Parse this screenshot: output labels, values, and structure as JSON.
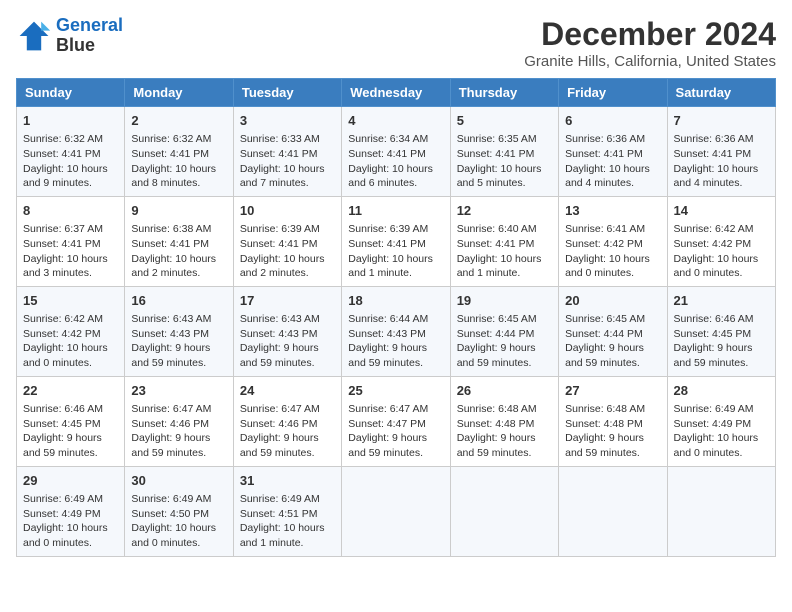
{
  "logo": {
    "line1": "General",
    "line2": "Blue"
  },
  "title": "December 2024",
  "subtitle": "Granite Hills, California, United States",
  "days_of_week": [
    "Sunday",
    "Monday",
    "Tuesday",
    "Wednesday",
    "Thursday",
    "Friday",
    "Saturday"
  ],
  "weeks": [
    [
      {
        "day": "1",
        "info": [
          "Sunrise: 6:32 AM",
          "Sunset: 4:41 PM",
          "Daylight: 10 hours",
          "and 9 minutes."
        ]
      },
      {
        "day": "2",
        "info": [
          "Sunrise: 6:32 AM",
          "Sunset: 4:41 PM",
          "Daylight: 10 hours",
          "and 8 minutes."
        ]
      },
      {
        "day": "3",
        "info": [
          "Sunrise: 6:33 AM",
          "Sunset: 4:41 PM",
          "Daylight: 10 hours",
          "and 7 minutes."
        ]
      },
      {
        "day": "4",
        "info": [
          "Sunrise: 6:34 AM",
          "Sunset: 4:41 PM",
          "Daylight: 10 hours",
          "and 6 minutes."
        ]
      },
      {
        "day": "5",
        "info": [
          "Sunrise: 6:35 AM",
          "Sunset: 4:41 PM",
          "Daylight: 10 hours",
          "and 5 minutes."
        ]
      },
      {
        "day": "6",
        "info": [
          "Sunrise: 6:36 AM",
          "Sunset: 4:41 PM",
          "Daylight: 10 hours",
          "and 4 minutes."
        ]
      },
      {
        "day": "7",
        "info": [
          "Sunrise: 6:36 AM",
          "Sunset: 4:41 PM",
          "Daylight: 10 hours",
          "and 4 minutes."
        ]
      }
    ],
    [
      {
        "day": "8",
        "info": [
          "Sunrise: 6:37 AM",
          "Sunset: 4:41 PM",
          "Daylight: 10 hours",
          "and 3 minutes."
        ]
      },
      {
        "day": "9",
        "info": [
          "Sunrise: 6:38 AM",
          "Sunset: 4:41 PM",
          "Daylight: 10 hours",
          "and 2 minutes."
        ]
      },
      {
        "day": "10",
        "info": [
          "Sunrise: 6:39 AM",
          "Sunset: 4:41 PM",
          "Daylight: 10 hours",
          "and 2 minutes."
        ]
      },
      {
        "day": "11",
        "info": [
          "Sunrise: 6:39 AM",
          "Sunset: 4:41 PM",
          "Daylight: 10 hours",
          "and 1 minute."
        ]
      },
      {
        "day": "12",
        "info": [
          "Sunrise: 6:40 AM",
          "Sunset: 4:41 PM",
          "Daylight: 10 hours",
          "and 1 minute."
        ]
      },
      {
        "day": "13",
        "info": [
          "Sunrise: 6:41 AM",
          "Sunset: 4:42 PM",
          "Daylight: 10 hours",
          "and 0 minutes."
        ]
      },
      {
        "day": "14",
        "info": [
          "Sunrise: 6:42 AM",
          "Sunset: 4:42 PM",
          "Daylight: 10 hours",
          "and 0 minutes."
        ]
      }
    ],
    [
      {
        "day": "15",
        "info": [
          "Sunrise: 6:42 AM",
          "Sunset: 4:42 PM",
          "Daylight: 10 hours",
          "and 0 minutes."
        ]
      },
      {
        "day": "16",
        "info": [
          "Sunrise: 6:43 AM",
          "Sunset: 4:43 PM",
          "Daylight: 9 hours",
          "and 59 minutes."
        ]
      },
      {
        "day": "17",
        "info": [
          "Sunrise: 6:43 AM",
          "Sunset: 4:43 PM",
          "Daylight: 9 hours",
          "and 59 minutes."
        ]
      },
      {
        "day": "18",
        "info": [
          "Sunrise: 6:44 AM",
          "Sunset: 4:43 PM",
          "Daylight: 9 hours",
          "and 59 minutes."
        ]
      },
      {
        "day": "19",
        "info": [
          "Sunrise: 6:45 AM",
          "Sunset: 4:44 PM",
          "Daylight: 9 hours",
          "and 59 minutes."
        ]
      },
      {
        "day": "20",
        "info": [
          "Sunrise: 6:45 AM",
          "Sunset: 4:44 PM",
          "Daylight: 9 hours",
          "and 59 minutes."
        ]
      },
      {
        "day": "21",
        "info": [
          "Sunrise: 6:46 AM",
          "Sunset: 4:45 PM",
          "Daylight: 9 hours",
          "and 59 minutes."
        ]
      }
    ],
    [
      {
        "day": "22",
        "info": [
          "Sunrise: 6:46 AM",
          "Sunset: 4:45 PM",
          "Daylight: 9 hours",
          "and 59 minutes."
        ]
      },
      {
        "day": "23",
        "info": [
          "Sunrise: 6:47 AM",
          "Sunset: 4:46 PM",
          "Daylight: 9 hours",
          "and 59 minutes."
        ]
      },
      {
        "day": "24",
        "info": [
          "Sunrise: 6:47 AM",
          "Sunset: 4:46 PM",
          "Daylight: 9 hours",
          "and 59 minutes."
        ]
      },
      {
        "day": "25",
        "info": [
          "Sunrise: 6:47 AM",
          "Sunset: 4:47 PM",
          "Daylight: 9 hours",
          "and 59 minutes."
        ]
      },
      {
        "day": "26",
        "info": [
          "Sunrise: 6:48 AM",
          "Sunset: 4:48 PM",
          "Daylight: 9 hours",
          "and 59 minutes."
        ]
      },
      {
        "day": "27",
        "info": [
          "Sunrise: 6:48 AM",
          "Sunset: 4:48 PM",
          "Daylight: 9 hours",
          "and 59 minutes."
        ]
      },
      {
        "day": "28",
        "info": [
          "Sunrise: 6:49 AM",
          "Sunset: 4:49 PM",
          "Daylight: 10 hours",
          "and 0 minutes."
        ]
      }
    ],
    [
      {
        "day": "29",
        "info": [
          "Sunrise: 6:49 AM",
          "Sunset: 4:49 PM",
          "Daylight: 10 hours",
          "and 0 minutes."
        ]
      },
      {
        "day": "30",
        "info": [
          "Sunrise: 6:49 AM",
          "Sunset: 4:50 PM",
          "Daylight: 10 hours",
          "and 0 minutes."
        ]
      },
      {
        "day": "31",
        "info": [
          "Sunrise: 6:49 AM",
          "Sunset: 4:51 PM",
          "Daylight: 10 hours",
          "and 1 minute."
        ]
      },
      null,
      null,
      null,
      null
    ]
  ]
}
